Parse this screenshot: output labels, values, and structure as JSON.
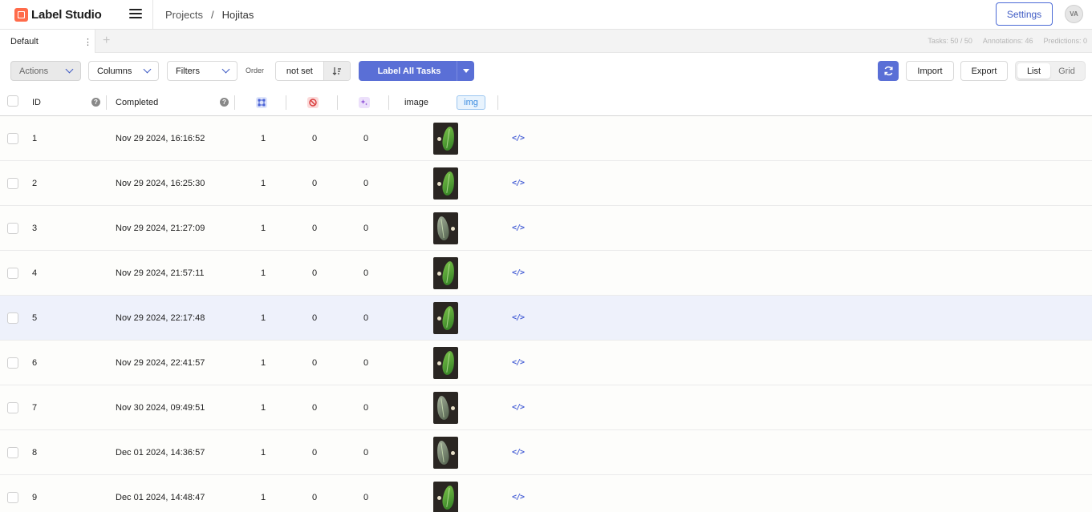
{
  "app": {
    "name": "Label Studio",
    "icon": "label-studio-logo"
  },
  "breadcrumb": {
    "projects": "Projects",
    "separator": "/",
    "current": "Hojitas"
  },
  "header": {
    "settings_label": "Settings",
    "avatar_initials": "VA"
  },
  "tabs": {
    "active": "Default",
    "add": "+"
  },
  "stats": {
    "tasks": "Tasks: 50 / 50",
    "annotations": "Annotations: 46",
    "predictions": "Predictions: 0"
  },
  "toolbar": {
    "actions": "Actions",
    "columns": "Columns",
    "filters": "Filters",
    "order_label": "Order",
    "order_value": "not set",
    "label_all": "Label All Tasks",
    "import": "Import",
    "export": "Export",
    "view_list": "List",
    "view_grid": "Grid"
  },
  "columns": {
    "id": "ID",
    "completed": "Completed",
    "image": "image",
    "image_tag": "img",
    "icons": [
      "annotations-icon",
      "cancelled-icon",
      "predictions-icon"
    ]
  },
  "colors": {
    "accent": "#5a6fd6",
    "highlight_row": "#eef1fb",
    "logo": "#ff6b4a"
  },
  "rows": [
    {
      "id": "1",
      "completed": "Nov 29 2024, 16:16:52",
      "ann": "1",
      "can": "0",
      "pred": "0",
      "image_alt": false
    },
    {
      "id": "2",
      "completed": "Nov 29 2024, 16:25:30",
      "ann": "1",
      "can": "0",
      "pred": "0",
      "image_alt": false
    },
    {
      "id": "3",
      "completed": "Nov 29 2024, 21:27:09",
      "ann": "1",
      "can": "0",
      "pred": "0",
      "image_alt": true
    },
    {
      "id": "4",
      "completed": "Nov 29 2024, 21:57:11",
      "ann": "1",
      "can": "0",
      "pred": "0",
      "image_alt": false
    },
    {
      "id": "5",
      "completed": "Nov 29 2024, 22:17:48",
      "ann": "1",
      "can": "0",
      "pred": "0",
      "image_alt": false
    },
    {
      "id": "6",
      "completed": "Nov 29 2024, 22:41:57",
      "ann": "1",
      "can": "0",
      "pred": "0",
      "image_alt": false
    },
    {
      "id": "7",
      "completed": "Nov 30 2024, 09:49:51",
      "ann": "1",
      "can": "0",
      "pred": "0",
      "image_alt": true
    },
    {
      "id": "8",
      "completed": "Dec 01 2024, 14:36:57",
      "ann": "1",
      "can": "0",
      "pred": "0",
      "image_alt": true
    },
    {
      "id": "9",
      "completed": "Dec 01 2024, 14:48:47",
      "ann": "1",
      "can": "0",
      "pred": "0",
      "image_alt": false
    }
  ],
  "highlighted_row_id": "5"
}
